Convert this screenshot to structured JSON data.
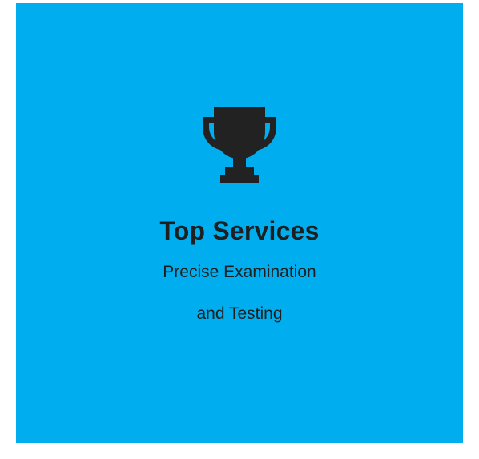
{
  "card": {
    "background_color": "#00aeef",
    "icon": "trophy-icon",
    "title": "Top Services",
    "subtitle_line1": "Precise Examination",
    "subtitle_line2": "and Testing"
  }
}
